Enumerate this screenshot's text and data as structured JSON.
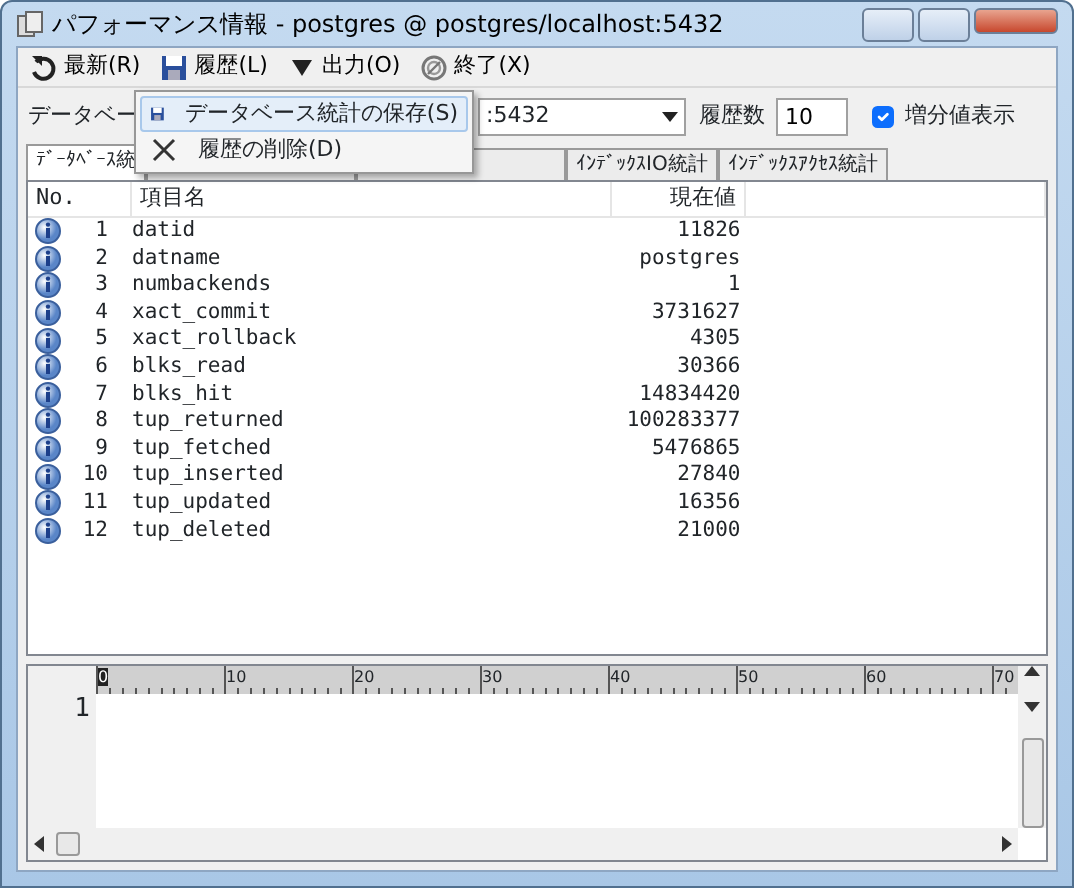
{
  "window": {
    "title": "パフォーマンス情報 - postgres @ postgres/localhost:5432"
  },
  "toolbar": [
    {
      "kind": "refresh",
      "label": "最新(R)"
    },
    {
      "kind": "save",
      "label": "履歴(L)"
    },
    {
      "kind": "dropdown",
      "label": "出力(O)"
    },
    {
      "kind": "stop",
      "label": "終了(X)"
    }
  ],
  "menu": [
    {
      "kind": "save",
      "label": "データベース統計の保存(S)",
      "selected": true
    },
    {
      "kind": "delete",
      "label": "履歴の削除(D)",
      "selected": false
    }
  ],
  "filter": {
    "database_label": "データベー",
    "database_value": ":5432",
    "history_label": "履歴数",
    "history_value": "10",
    "delta_label": "増分値表示",
    "delta_checked": true
  },
  "tabs": [
    {
      "label": "ﾃﾞｰﾀﾍﾞｰｽ統",
      "selected": true
    },
    {
      "selected": false
    },
    {
      "selected": false
    },
    {
      "label": "ｲﾝﾃﾞｯｸｽIO統計",
      "selected": false
    },
    {
      "label": "ｲﾝﾃﾞｯｸｽｱｸｾｽ統計",
      "selected": false
    }
  ],
  "table": {
    "columns": [
      "No.",
      "項目名",
      "現在値"
    ],
    "rows": [
      {
        "no": "1",
        "name": "datid",
        "value": "11826"
      },
      {
        "no": "2",
        "name": "datname",
        "value": "postgres"
      },
      {
        "no": "3",
        "name": "numbackends",
        "value": "1"
      },
      {
        "no": "4",
        "name": "xact_commit",
        "value": "3731627"
      },
      {
        "no": "5",
        "name": "xact_rollback",
        "value": "4305"
      },
      {
        "no": "6",
        "name": "blks_read",
        "value": "30366"
      },
      {
        "no": "7",
        "name": "blks_hit",
        "value": "14834420"
      },
      {
        "no": "8",
        "name": "tup_returned",
        "value": "100283377"
      },
      {
        "no": "9",
        "name": "tup_fetched",
        "value": "5476865"
      },
      {
        "no": "10",
        "name": "tup_inserted",
        "value": "27840"
      },
      {
        "no": "11",
        "name": "tup_updated",
        "value": "16356"
      },
      {
        "no": "12",
        "name": "tup_deleted",
        "value": "21000"
      }
    ]
  },
  "editor": {
    "ruler": [
      "0",
      "10",
      "20",
      "30",
      "40",
      "50",
      "60",
      "70"
    ],
    "line_numbers": [
      "1"
    ]
  }
}
